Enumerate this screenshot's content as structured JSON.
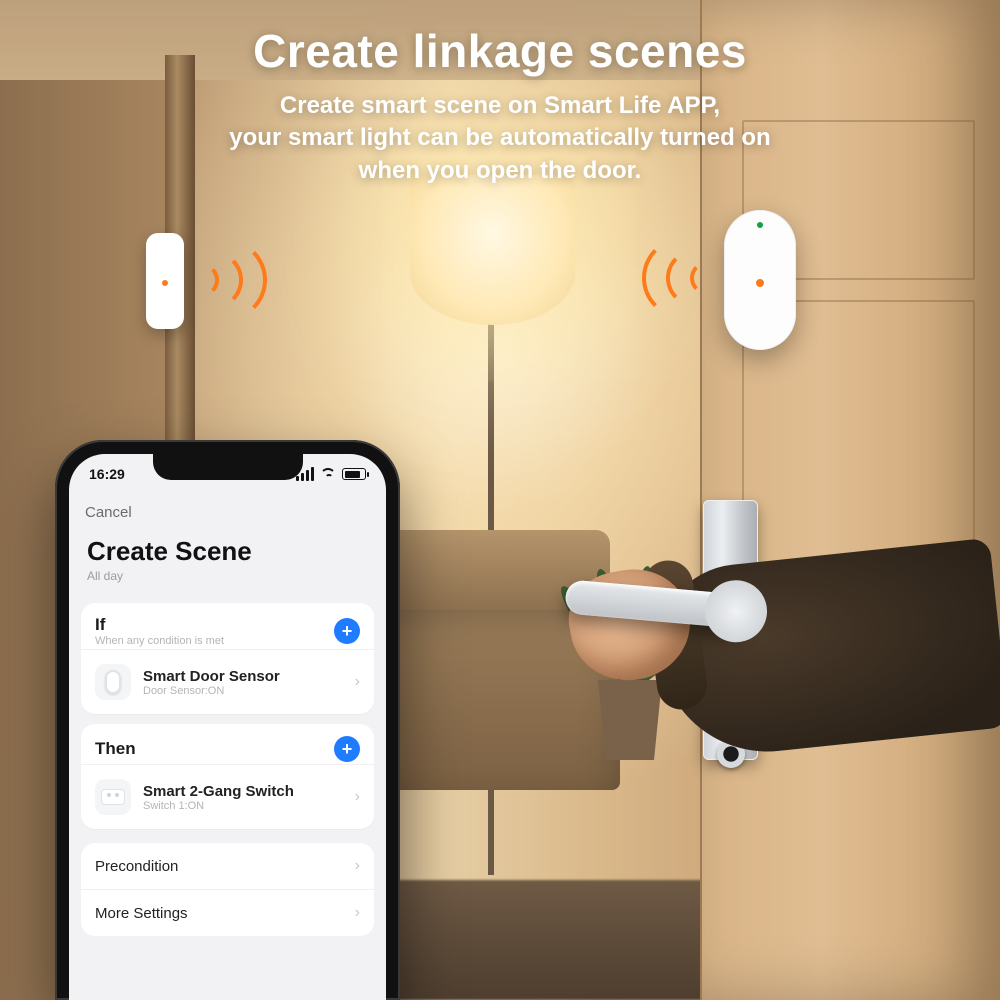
{
  "marketing": {
    "title": "Create linkage scenes",
    "subtitle": "Create smart scene on Smart Life APP,\nyour smart light can be automatically turned on\nwhen you open the door."
  },
  "phone": {
    "status": {
      "time": "16:29"
    },
    "nav": {
      "cancel": "Cancel"
    },
    "header": {
      "title": "Create Scene",
      "subtitle": "All day"
    },
    "if": {
      "title": "If",
      "hint": "When any condition is met",
      "device": {
        "name": "Smart Door Sensor",
        "state": "Door Sensor:ON"
      }
    },
    "then": {
      "title": "Then",
      "device": {
        "name": "Smart 2-Gang Switch",
        "state": "Switch 1:ON"
      }
    },
    "settings": {
      "precondition": "Precondition",
      "more": "More Settings"
    }
  }
}
